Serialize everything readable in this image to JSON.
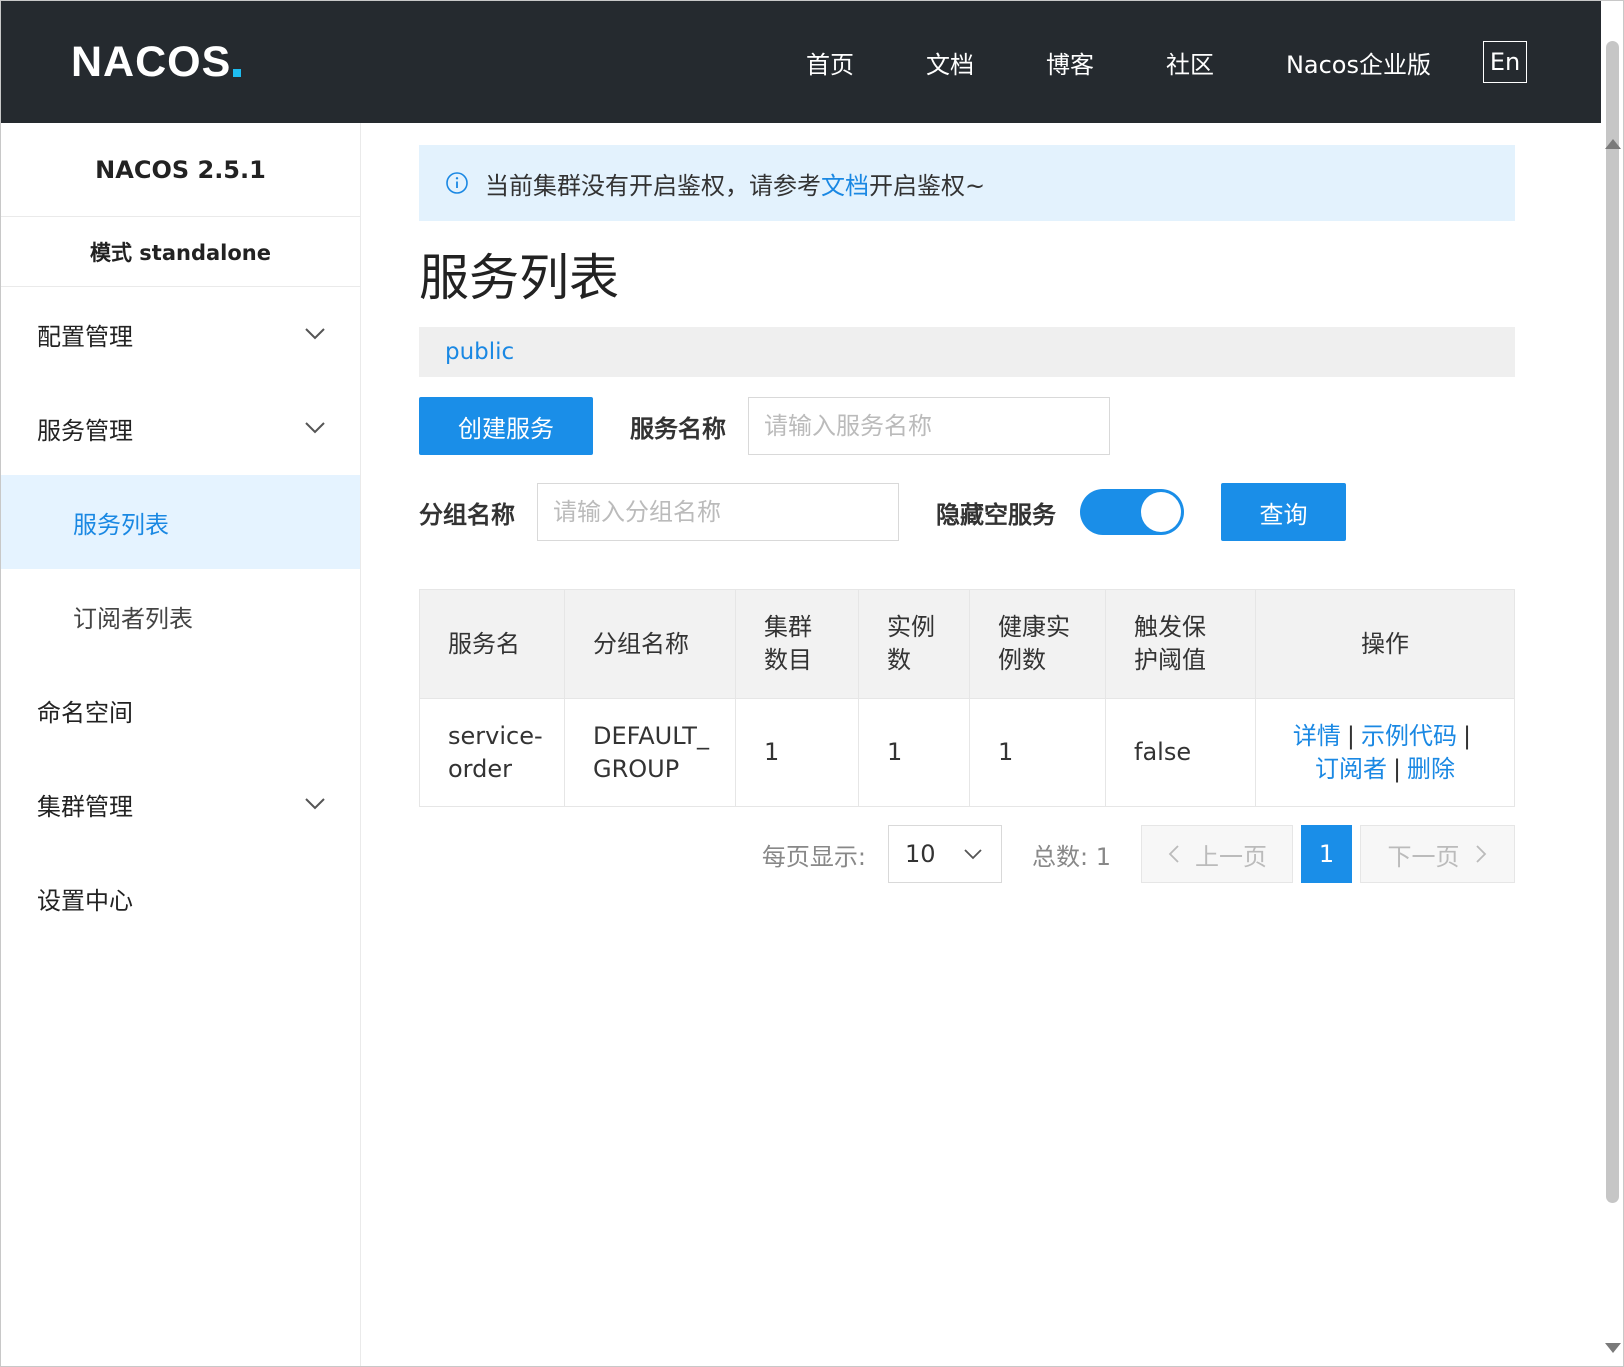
{
  "app": {
    "logo": "NACOS",
    "accent_color": "#1a8ee8",
    "topbar_color": "#252a2f"
  },
  "nav": {
    "items": [
      "首页",
      "文档",
      "博客",
      "社区",
      "Nacos企业版"
    ],
    "lang": "En"
  },
  "sidebar": {
    "version": "NACOS 2.5.1",
    "mode": "模式 standalone",
    "items": [
      {
        "label": "配置管理",
        "expandable": true
      },
      {
        "label": "服务管理",
        "expandable": true
      },
      {
        "label": "服务列表",
        "sub": true,
        "active": true
      },
      {
        "label": "订阅者列表",
        "sub": true
      },
      {
        "label": "命名空间"
      },
      {
        "label": "集群管理",
        "expandable": true
      },
      {
        "label": "设置中心"
      }
    ]
  },
  "notice": {
    "icon": "info-icon",
    "text_before": "当前集群没有开启鉴权，请参考",
    "link": "文档",
    "text_after": "开启鉴权~"
  },
  "page": {
    "title": "服务列表",
    "namespace": "public"
  },
  "filters": {
    "create_button": "创建服务",
    "service_name_label": "服务名称",
    "service_name_placeholder": "请输入服务名称",
    "group_name_label": "分组名称",
    "group_name_placeholder": "请输入分组名称",
    "hide_empty_label": "隐藏空服务",
    "hide_empty_on": true,
    "query_button": "查询"
  },
  "table": {
    "columns": [
      "服务名",
      "分组名称",
      "集群\n数目",
      "实例\n数",
      "健康实\n例数",
      "触发保\n护阈值",
      "操作"
    ],
    "rows": [
      {
        "service_name": "service-\norder",
        "group_name": "DEFAULT_\nGROUP",
        "cluster_count": "1",
        "instance_count": "1",
        "healthy_count": "1",
        "protect_threshold": "false",
        "actions": [
          "详情",
          "示例代码",
          "订阅者",
          "删除"
        ]
      }
    ]
  },
  "pagination": {
    "page_size_label": "每页显示:",
    "page_size": "10",
    "total_label": "总数: 1",
    "prev": "上一页",
    "current": "1",
    "next": "下一页"
  }
}
